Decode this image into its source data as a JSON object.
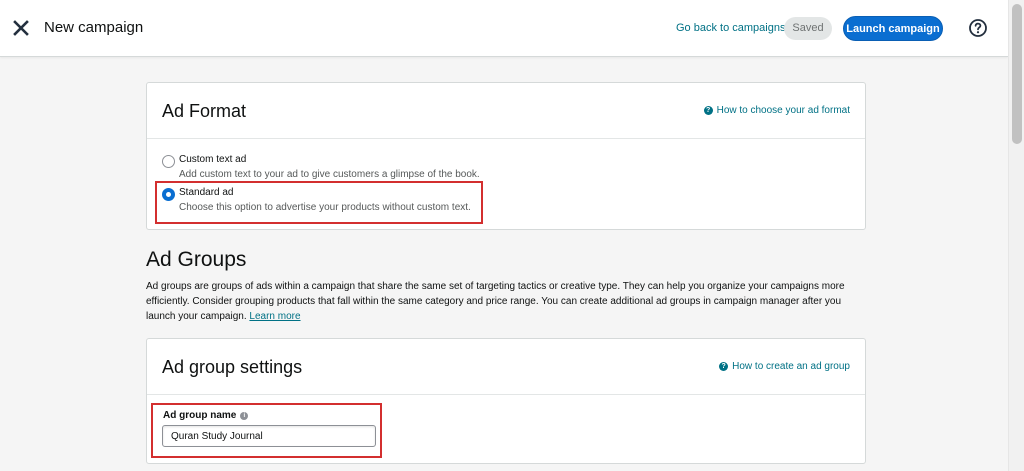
{
  "topbar": {
    "title": "New campaign",
    "back_link": "Go back to campaigns",
    "saved_label": "Saved",
    "launch_label": "Launch campaign",
    "close_icon": "close-icon",
    "help_icon": "help-circle-icon"
  },
  "ad_format": {
    "title": "Ad Format",
    "help_link": "How to choose your ad format",
    "options": [
      {
        "label": "Custom text ad",
        "description": "Add custom text to your ad to give customers a glimpse of the book.",
        "selected": false
      },
      {
        "label": "Standard ad",
        "description": "Choose this option to advertise your products without custom text.",
        "selected": true
      }
    ]
  },
  "ad_groups": {
    "title": "Ad Groups",
    "description": "Ad groups are groups of ads within a campaign that share the same set of targeting tactics or creative type. They can help you organize your campaigns more efficiently. Consider grouping products that fall within the same category and price range. You can create additional ad groups in campaign manager after you launch your campaign.",
    "learn_more": "Learn more"
  },
  "ad_group_settings": {
    "title": "Ad group settings",
    "help_link": "How to create an ad group",
    "name_label": "Ad group name",
    "name_value": "Quran Study Journal"
  },
  "colors": {
    "accent": "#0a6ed1",
    "link": "#007185",
    "highlight": "#d32f2f"
  }
}
